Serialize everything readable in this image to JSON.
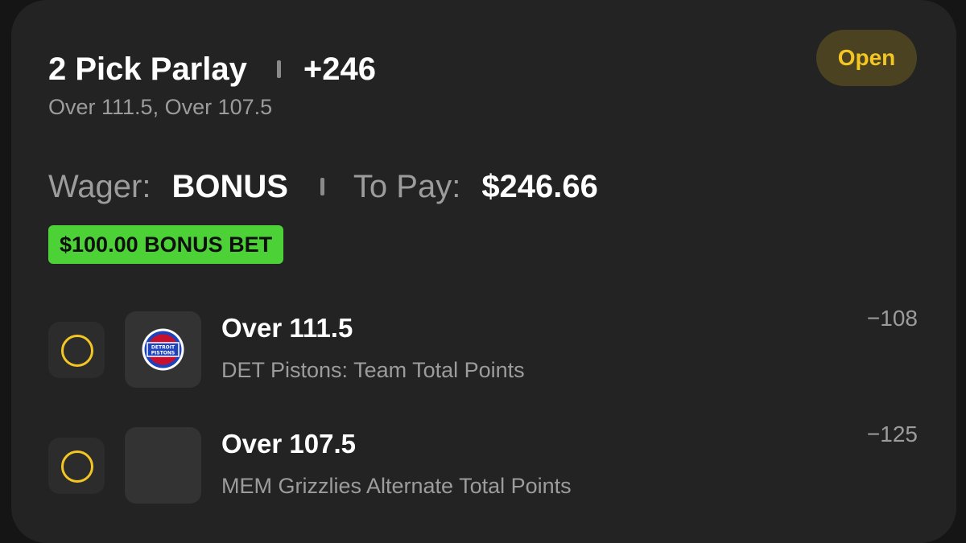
{
  "header": {
    "title": "2 Pick Parlay",
    "odds": "+246",
    "subtitle": "Over 111.5, Over 107.5",
    "status": "Open"
  },
  "wager": {
    "wager_label": "Wager:",
    "wager_value": "BONUS",
    "to_pay_label": "To Pay:",
    "to_pay_value": "$246.66"
  },
  "bonus_badge": "$100.00 BONUS BET",
  "legs": [
    {
      "title": "Over 111.5",
      "description": "DET Pistons: Team Total Points",
      "odds": "−108",
      "logo_text": "DETROIT PISTONS"
    },
    {
      "title": "Over 107.5",
      "description": "MEM Grizzlies Alternate Total Points",
      "odds": "−125"
    }
  ],
  "colors": {
    "accent_yellow": "#f3c623",
    "bonus_green": "#4cd137",
    "card_bg": "#232323",
    "pistons_red": "#c8102e",
    "pistons_blue": "#1d42ba"
  }
}
